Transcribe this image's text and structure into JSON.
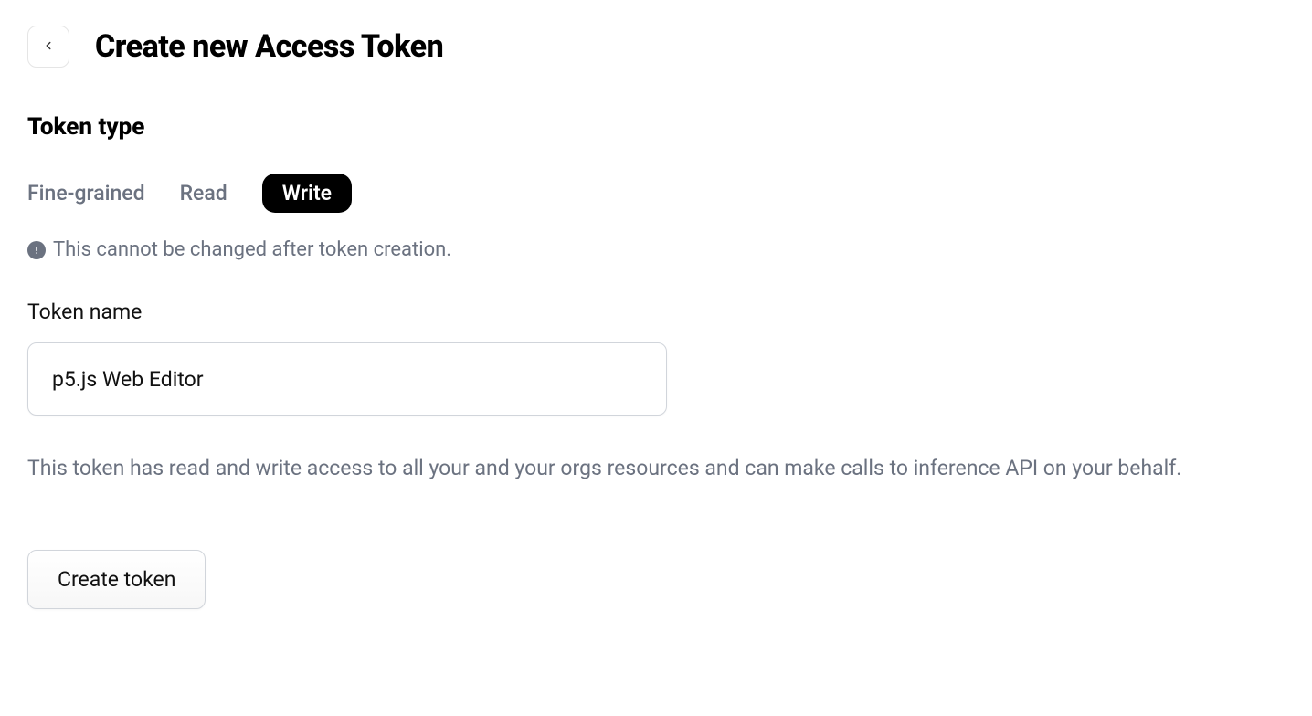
{
  "header": {
    "title": "Create new Access Token"
  },
  "tokenType": {
    "section_label": "Token type",
    "tabs": [
      {
        "label": "Fine-grained"
      },
      {
        "label": "Read"
      },
      {
        "label": "Write"
      }
    ],
    "hint": "This cannot be changed after token creation."
  },
  "tokenName": {
    "label": "Token name",
    "value": "p5.js Web Editor"
  },
  "description": "This token has read and write access to all your and your orgs resources and can make calls to inference API on your behalf.",
  "actions": {
    "create_label": "Create token"
  }
}
